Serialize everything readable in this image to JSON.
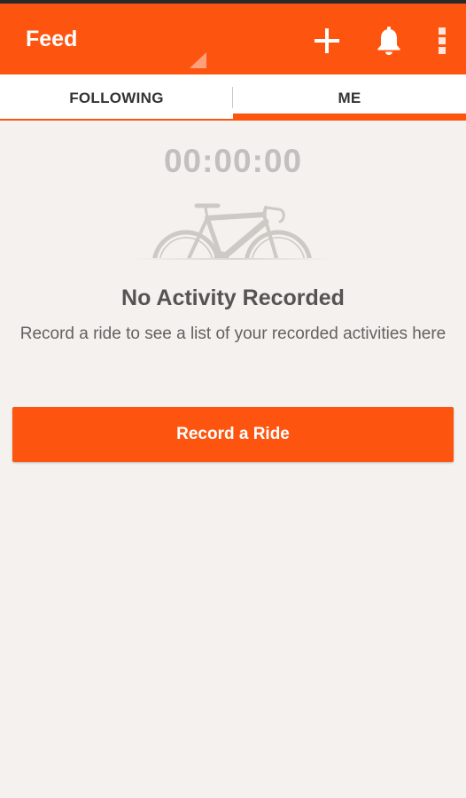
{
  "app_bar": {
    "title": "Feed",
    "actions": [
      {
        "name": "add",
        "icon": "plus-icon"
      },
      {
        "name": "notifications",
        "icon": "bell-icon"
      },
      {
        "name": "overflow",
        "icon": "more-vertical-icon"
      }
    ]
  },
  "tabs": [
    {
      "label": "FOLLOWING",
      "selected": false
    },
    {
      "label": "ME",
      "selected": true
    }
  ],
  "me_tab": {
    "timer": "00:00:00",
    "illustration_icon": "bicycle-icon",
    "empty_title": "No Activity Recorded",
    "empty_message": "Record a ride to see a list of your recorded activities here",
    "record_button_label": "Record a Ride"
  },
  "colors": {
    "brand_orange": "#fd5510",
    "background": "#f4f1ee",
    "timer_text": "#c2c0be",
    "title_text": "#555452",
    "body_text": "#636260"
  }
}
